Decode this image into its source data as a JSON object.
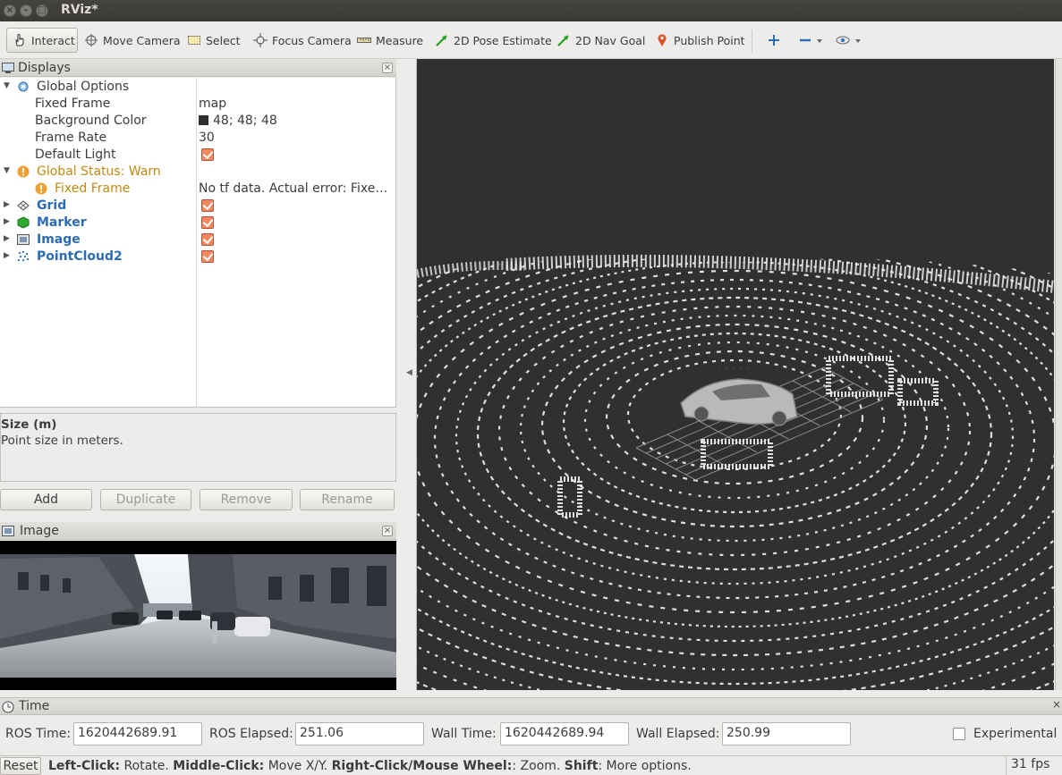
{
  "window": {
    "title": "RViz*"
  },
  "toolbar": {
    "interact": "Interact",
    "move_camera": "Move Camera",
    "select": "Select",
    "focus_camera": "Focus Camera",
    "measure": "Measure",
    "pose_estimate": "2D Pose Estimate",
    "nav_goal": "2D Nav Goal",
    "publish_point": "Publish Point"
  },
  "displays": {
    "title": "Displays",
    "global_options": {
      "label": "Global Options",
      "fixed_frame_label": "Fixed Frame",
      "fixed_frame_value": "map",
      "background_color_label": "Background Color",
      "background_color_value": "48; 48; 48",
      "background_color_hex": "#303030",
      "frame_rate_label": "Frame Rate",
      "frame_rate_value": "30",
      "default_light_label": "Default Light",
      "default_light_checked": true
    },
    "global_status": {
      "label": "Global Status: Warn",
      "child_label": "Fixed Frame",
      "child_value": "No tf data.  Actual error: Fixe…",
      "color": "#c28a12"
    },
    "items": [
      {
        "label": "Grid",
        "icon": "grid-icon",
        "checked": true
      },
      {
        "label": "Marker",
        "icon": "marker-icon",
        "checked": true
      },
      {
        "label": "Image",
        "icon": "image-icon",
        "checked": true
      },
      {
        "label": "PointCloud2",
        "icon": "pointcloud-icon",
        "checked": true
      }
    ]
  },
  "description": {
    "title": "Size (m)",
    "text": "Point size in meters."
  },
  "panel_buttons": {
    "add": "Add",
    "duplicate": "Duplicate",
    "remove": "Remove",
    "rename": "Rename"
  },
  "image_panel": {
    "title": "Image"
  },
  "time_panel": {
    "title": "Time",
    "ros_time_label": "ROS Time:",
    "ros_time_value": "1620442689.91",
    "ros_elapsed_label": "ROS Elapsed:",
    "ros_elapsed_value": "251.06",
    "wall_time_label": "Wall Time:",
    "wall_time_value": "1620442689.94",
    "wall_elapsed_label": "Wall Elapsed:",
    "wall_elapsed_value": "250.99",
    "experimental_label": "Experimental",
    "experimental_checked": false
  },
  "status_bar": {
    "reset": "Reset",
    "hint_b1": "Left-Click:",
    "hint_t1": " Rotate. ",
    "hint_b2": "Middle-Click:",
    "hint_t2": " Move X/Y. ",
    "hint_b3": "Right-Click/Mouse Wheel:",
    "hint_t3": ": Zoom. ",
    "hint_b4": "Shift",
    "hint_t4": ": More options.",
    "fps": "31 fps"
  }
}
